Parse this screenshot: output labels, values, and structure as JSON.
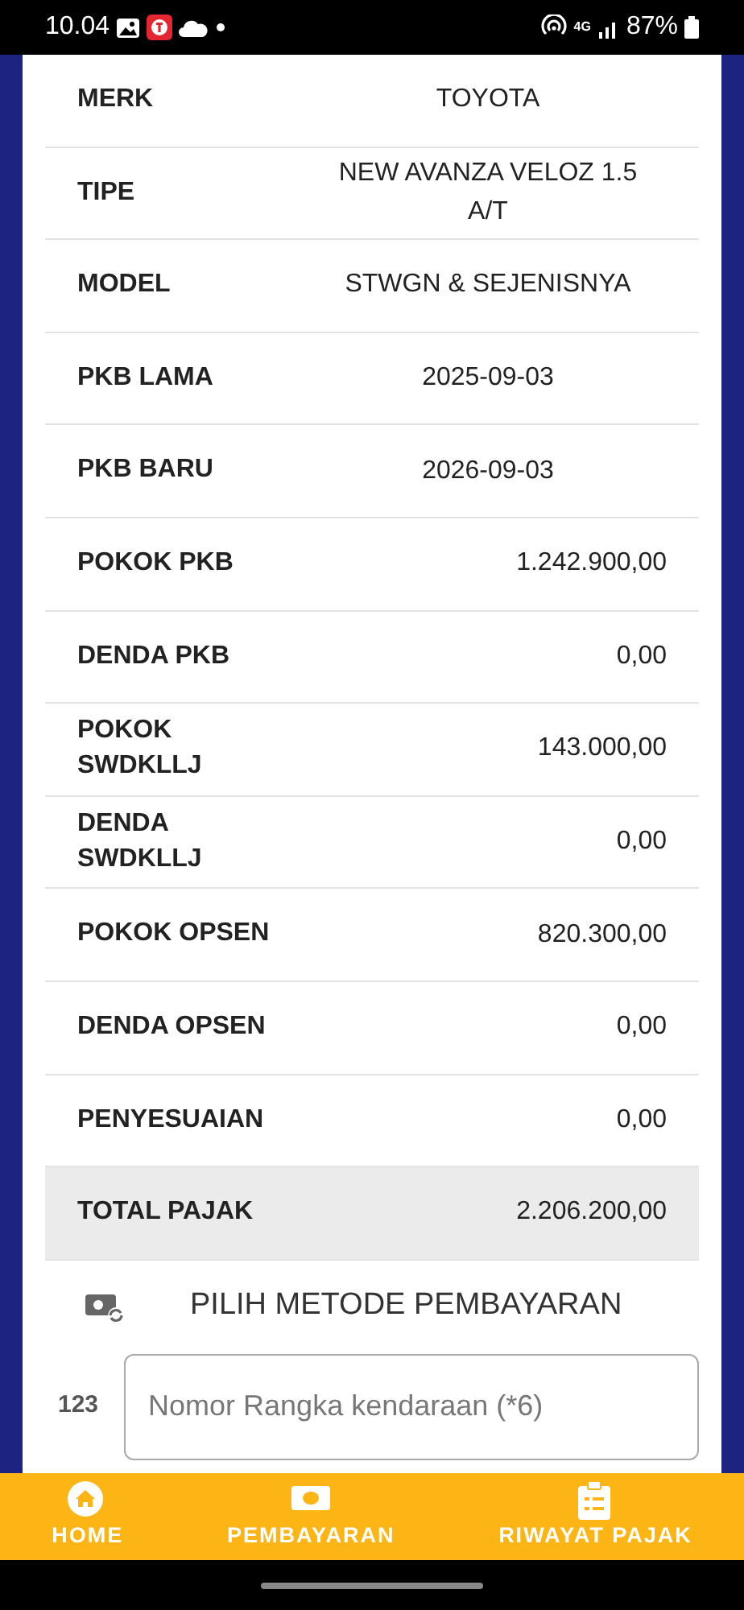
{
  "status_bar": {
    "time": "10.04",
    "network": "4G",
    "battery": "87%"
  },
  "details": [
    {
      "label": "MERK",
      "value": "TOYOTA",
      "kind": "text",
      "highlight": false
    },
    {
      "label": "TIPE",
      "value": "NEW AVANZA VELOZ 1.5 A/T",
      "kind": "text",
      "highlight": false
    },
    {
      "label": "MODEL",
      "value": "STWGN & SEJENISNYA",
      "kind": "text",
      "highlight": false
    },
    {
      "label": "PKB LAMA",
      "value": "2025-09-03",
      "kind": "text",
      "highlight": false
    },
    {
      "label": "PKB BARU",
      "value": "2026-09-03",
      "kind": "text",
      "highlight": false
    },
    {
      "label": "POKOK PKB",
      "value": "1.242.900,00",
      "kind": "amount",
      "highlight": false
    },
    {
      "label": "DENDA PKB",
      "value": "0,00",
      "kind": "amount",
      "highlight": false
    },
    {
      "label": "POKOK SWDKLLJ",
      "value": "143.000,00",
      "kind": "amount",
      "highlight": false
    },
    {
      "label": "DENDA SWDKLLJ",
      "value": "0,00",
      "kind": "amount",
      "highlight": false
    },
    {
      "label": "POKOK OPSEN",
      "value": "820.300,00",
      "kind": "amount",
      "highlight": false
    },
    {
      "label": "DENDA OPSEN",
      "value": "0,00",
      "kind": "amount",
      "highlight": false
    },
    {
      "label": "PENYESUAIAN",
      "value": "0,00",
      "kind": "amount",
      "highlight": false
    },
    {
      "label": "TOTAL PAJAK",
      "value": "2.206.200,00",
      "kind": "amount",
      "highlight": true
    }
  ],
  "payment_method": {
    "label": "PILIH METODE PEMBAYARAN"
  },
  "frame_number": {
    "prefix": "123",
    "placeholder": "Nomor Rangka kendaraan (*6)"
  },
  "bottom_nav": [
    {
      "label": "HOME",
      "kind": "home"
    },
    {
      "label": "PEMBAYARAN",
      "kind": "payment"
    },
    {
      "label": "RIWAYAT PAJAK",
      "kind": "history"
    }
  ]
}
